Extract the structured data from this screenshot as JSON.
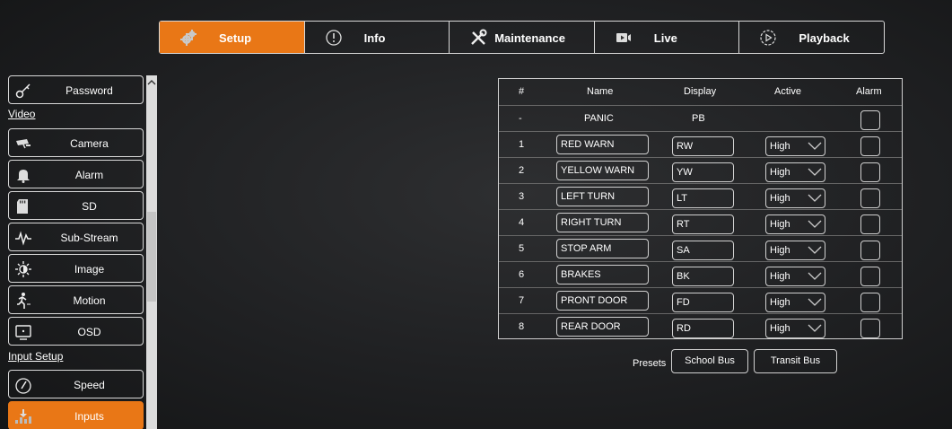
{
  "nav": {
    "tabs": [
      {
        "label": "Setup",
        "icon": "gear-icon",
        "active": true
      },
      {
        "label": "Info",
        "icon": "info-icon",
        "active": false
      },
      {
        "label": "Maintenance",
        "icon": "tools-icon",
        "active": false
      },
      {
        "label": "Live",
        "icon": "video-camera-icon",
        "active": false
      },
      {
        "label": "Playback",
        "icon": "play-icon",
        "active": false
      }
    ],
    "accent": "#e97716"
  },
  "sidebar": {
    "items": [
      {
        "label": "Password",
        "icon": "key-icon"
      },
      {
        "label": "Camera",
        "icon": "camera-icon"
      },
      {
        "label": "Alarm",
        "icon": "bell-icon"
      },
      {
        "label": "SD",
        "icon": "sd-card-icon"
      },
      {
        "label": "Sub-Stream",
        "icon": "waveform-icon"
      },
      {
        "label": "Image",
        "icon": "brightness-icon"
      },
      {
        "label": "Motion",
        "icon": "motion-icon"
      },
      {
        "label": "OSD",
        "icon": "osd-icon"
      },
      {
        "label": "Speed",
        "icon": "speedometer-icon"
      },
      {
        "label": "Inputs",
        "icon": "inputs-icon",
        "active": true
      }
    ],
    "sections": {
      "video": "Video",
      "input_setup": "Input Setup"
    }
  },
  "table": {
    "headers": {
      "num": "#",
      "name": "Name",
      "display": "Display",
      "active": "Active",
      "alarm": "Alarm"
    },
    "panic": {
      "num": "-",
      "name": "PANIC",
      "display": "PB"
    },
    "rows": [
      {
        "num": "1",
        "name": "RED WARN",
        "display": "RW",
        "active": "High"
      },
      {
        "num": "2",
        "name": "YELLOW WARN",
        "display": "YW",
        "active": "High"
      },
      {
        "num": "3",
        "name": "LEFT TURN",
        "display": "LT",
        "active": "High"
      },
      {
        "num": "4",
        "name": "RIGHT TURN",
        "display": "RT",
        "active": "High"
      },
      {
        "num": "5",
        "name": "STOP ARM",
        "display": "SA",
        "active": "High"
      },
      {
        "num": "6",
        "name": "BRAKES",
        "display": "BK",
        "active": "High"
      },
      {
        "num": "7",
        "name": "PRONT DOOR",
        "display": "FD",
        "active": "High"
      },
      {
        "num": "8",
        "name": "REAR DOOR",
        "display": "RD",
        "active": "High"
      }
    ]
  },
  "presets": {
    "label": "Presets",
    "school_bus": "School Bus",
    "transit_bus": "Transit Bus"
  }
}
